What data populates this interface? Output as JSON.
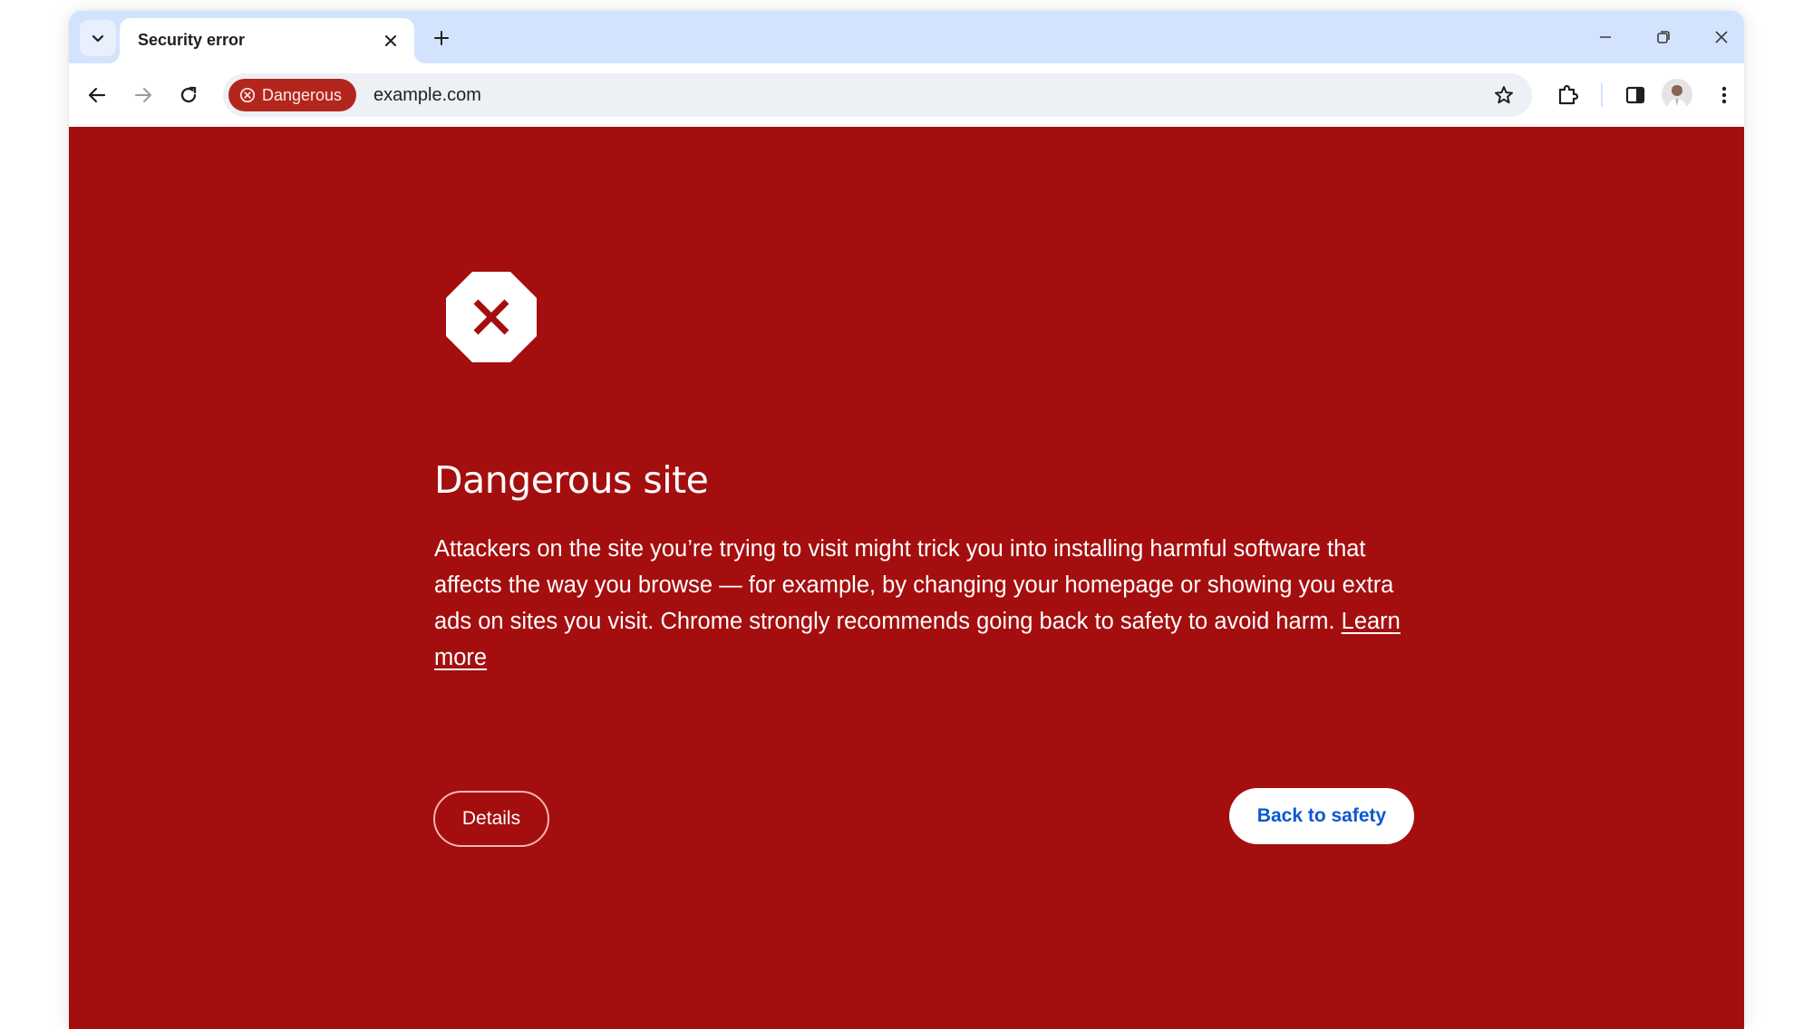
{
  "browser": {
    "tabs": [
      {
        "title": "Security error",
        "active": true
      }
    ],
    "tab_search_icon": "chevron-down-icon",
    "new_tab_icon": "plus-icon",
    "window_controls": [
      "minimize",
      "restore",
      "close"
    ],
    "toolbar": {
      "back_icon": "arrow-left-icon",
      "forward_icon": "arrow-right-icon",
      "reload_icon": "reload-icon",
      "security_chip": {
        "label": "Dangerous",
        "icon": "x-circle-icon",
        "color": "#b3261e"
      },
      "url": "example.com",
      "bookmark_icon": "star-icon",
      "extensions_icon": "puzzle-icon",
      "side_panel_icon": "side-panel-icon",
      "profile": "avatar",
      "menu_icon": "kebab-menu-icon"
    }
  },
  "interstitial": {
    "background_color": "#a50e0e",
    "icon": "stop-x-icon",
    "heading": "Dangerous site",
    "body": "Attackers on the site you’re trying to visit might trick you into installing harmful software that affects the way you browse — for example, by changing your homepage or showing you extra ads on sites you visit. Chrome strongly recommends going back to safety to avoid harm.",
    "learn_more": "Learn more",
    "details_button": "Details",
    "back_button": "Back to safety",
    "back_button_color": "#0b57d0"
  }
}
